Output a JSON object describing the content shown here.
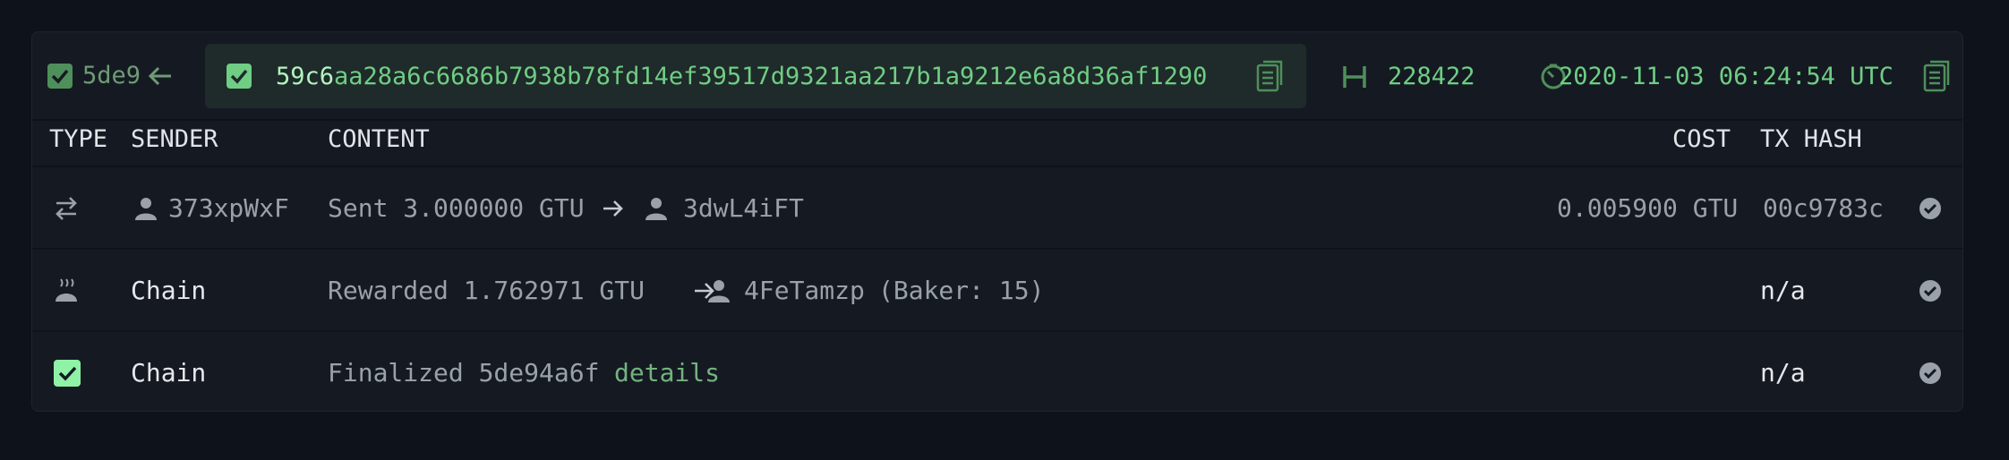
{
  "header": {
    "block_short": "5de9",
    "hash_prefix": "59c6",
    "hash_rest": "aa28a6c6686b7938b78fd14ef39517d9321aa217b1a9212e6a8d36af1290",
    "height": "228422",
    "timestamp": "2020-11-03 06:24:54 UTC",
    "icons": [
      "checkbox-checked-icon",
      "arrow-left-icon",
      "checkbox-checked-icon",
      "copy-icon",
      "height-icon",
      "timer-icon",
      "copy-icon"
    ]
  },
  "columns": {
    "type": "TYPE",
    "sender": "SENDER",
    "content": "CONTENT",
    "cost": "COST",
    "tx_hash": "TX HASH"
  },
  "rows": [
    {
      "type_icon": "transfer-icon",
      "sender": "373xpWxF",
      "content_action": "Sent 3.000000 GTU",
      "recipient": "3dwL4iFT",
      "cost": "0.005900 GTU",
      "tx_hash": "00c9783c",
      "status_icon": "check-circle-icon"
    },
    {
      "type_icon": "baker-icon",
      "sender": "Chain",
      "content_action": "Rewarded 1.762971 GTU",
      "recipient": "4FeTamzp",
      "recipient_suffix": "(Baker: 15)",
      "tx_hash": "n/a",
      "status_icon": "check-circle-icon"
    },
    {
      "type_icon": "checkbox-checked-icon",
      "sender": "Chain",
      "content_action": "Finalized 5de94a6f",
      "link": "details",
      "tx_hash": "n/a",
      "status_icon": "check-circle-icon"
    }
  ],
  "colors": {
    "accent_green": "#6fce84",
    "background": "#0e121a",
    "panel": "#151a22"
  }
}
